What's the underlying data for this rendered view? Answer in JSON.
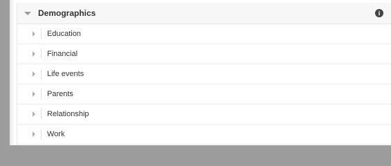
{
  "section": {
    "title": "Demographics",
    "info_icon": "info-icon"
  },
  "items": [
    {
      "label": "Education"
    },
    {
      "label": "Financial"
    },
    {
      "label": "Life events"
    },
    {
      "label": "Parents"
    },
    {
      "label": "Relationship"
    },
    {
      "label": "Work"
    }
  ],
  "colors": {
    "background": "#9c9c9c",
    "panel": "#ffffff",
    "header": "#f7f7f7",
    "text": "#333333"
  }
}
